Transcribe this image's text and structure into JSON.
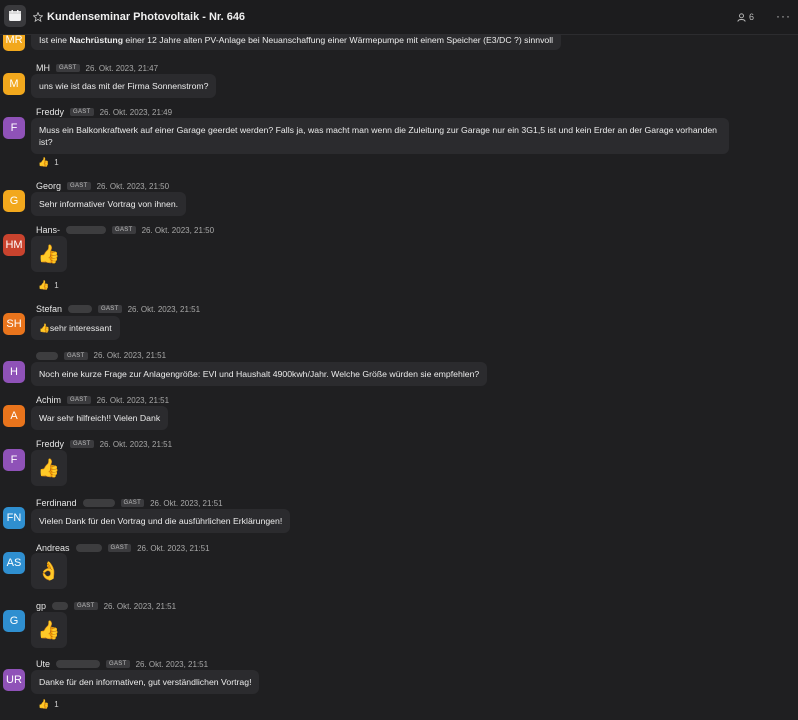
{
  "header": {
    "title": "Kundenseminar Photovoltaik - Nr. 646",
    "member_count": "6",
    "more": "···"
  },
  "messages": [
    {
      "initials": "MR",
      "text_pre": "Ist eine ",
      "text_bold": "Nachrüstung",
      "text_post": " einer 12 Jahre alten PV-Anlage bei Neuanschaffung einer Wärmepumpe mit einem Speicher (E3/DC ?) sinnvoll"
    },
    {
      "initials": "M",
      "name": "MH",
      "badge": "GAST",
      "time": "26. Okt. 2023, 21:47",
      "text": "uns wie ist das mit der Firma Sonnenstrom?"
    },
    {
      "initials": "F",
      "name": "Freddy",
      "badge": "GAST",
      "time": "26. Okt. 2023, 21:49",
      "text": "Muss ein Balkonkraftwerk auf einer Garage geerdet werden? Falls ja, was macht man wenn die Zuleitung zur Garage nur ein 3G1,5 ist und kein Erder an der Garage vorhanden ist?",
      "reaction_emoji": "👍",
      "reaction_count": "1"
    },
    {
      "initials": "G",
      "name": "Georg",
      "badge": "GAST",
      "time": "26. Okt. 2023, 21:50",
      "text": "Sehr informativer Vortrag von ihnen."
    },
    {
      "initials": "HM",
      "name": "Hans-",
      "badge": "GAST",
      "time": "26. Okt. 2023, 21:50",
      "emoji": "👍",
      "reaction_emoji": "👍",
      "reaction_count": "1"
    },
    {
      "initials": "SH",
      "name": "Stefan",
      "badge": "GAST",
      "time": "26. Okt. 2023, 21:51",
      "text": "👍sehr interessant"
    },
    {
      "initials": "H",
      "name": "",
      "badge": "GAST",
      "time": "26. Okt. 2023, 21:51",
      "text": "Noch eine kurze Frage zur Anlagengröße: EVI und Haushalt 4900kwh/Jahr. Welche Größe würden sie empfehlen?"
    },
    {
      "initials": "A",
      "name": "Achim",
      "badge": "GAST",
      "time": "26. Okt. 2023, 21:51",
      "text": "War sehr hilfreich!! Vielen Dank"
    },
    {
      "initials": "F",
      "name": "Freddy",
      "badge": "GAST",
      "time": "26. Okt. 2023, 21:51",
      "emoji": "👍"
    },
    {
      "initials": "FN",
      "name": "Ferdinand",
      "badge": "GAST",
      "time": "26. Okt. 2023, 21:51",
      "text": "Vielen Dank für den Vortrag und die ausführlichen Erklärungen!"
    },
    {
      "initials": "AS",
      "name": "Andreas",
      "badge": "GAST",
      "time": "26. Okt. 2023, 21:51",
      "emoji": "👌"
    },
    {
      "initials": "G",
      "name": "gp",
      "badge": "GAST",
      "time": "26. Okt. 2023, 21:51",
      "emoji": "👍"
    },
    {
      "initials": "UR",
      "name": "Ute",
      "badge": "GAST",
      "time": "26. Okt. 2023, 21:51",
      "text": "Danke für den informativen, gut verständlichen Vortrag!",
      "reaction_emoji": "👍",
      "reaction_count": "1"
    }
  ],
  "colors": {
    "background": "#1f1f21",
    "bubble": "#2b2b2e",
    "avatar_yellow": "#f2a81d",
    "avatar_purple": "#8f52b8",
    "avatar_red": "#c9432e",
    "avatar_orange": "#e9741c",
    "avatar_blue": "#2f8fd0"
  },
  "icons": [
    "calendar-icon",
    "star-icon",
    "person-icon",
    "more-icon"
  ]
}
